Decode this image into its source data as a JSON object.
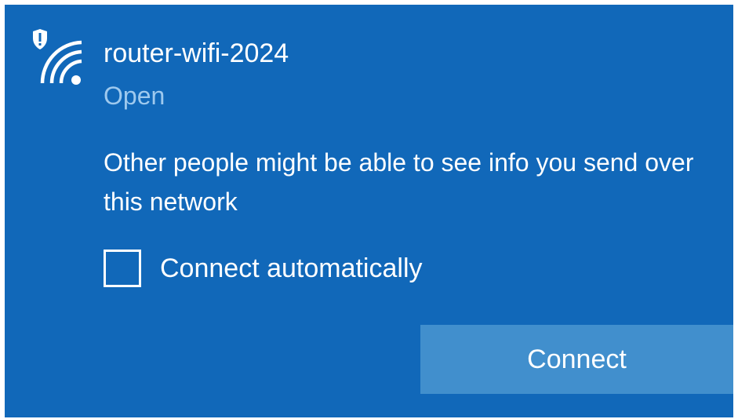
{
  "network": {
    "icon": "wifi-shield-warning-icon",
    "ssid": "router-wifi-2024",
    "status": "Open"
  },
  "warning_text": "Other people might be able to see info you send over this network",
  "auto_connect": {
    "label": "Connect automatically",
    "checked": false
  },
  "connect_button": {
    "label": "Connect"
  },
  "colors": {
    "panel_background": "#1168b9",
    "status_text": "#9ec9ee",
    "button_background": "#418fcd",
    "text": "#ffffff"
  }
}
